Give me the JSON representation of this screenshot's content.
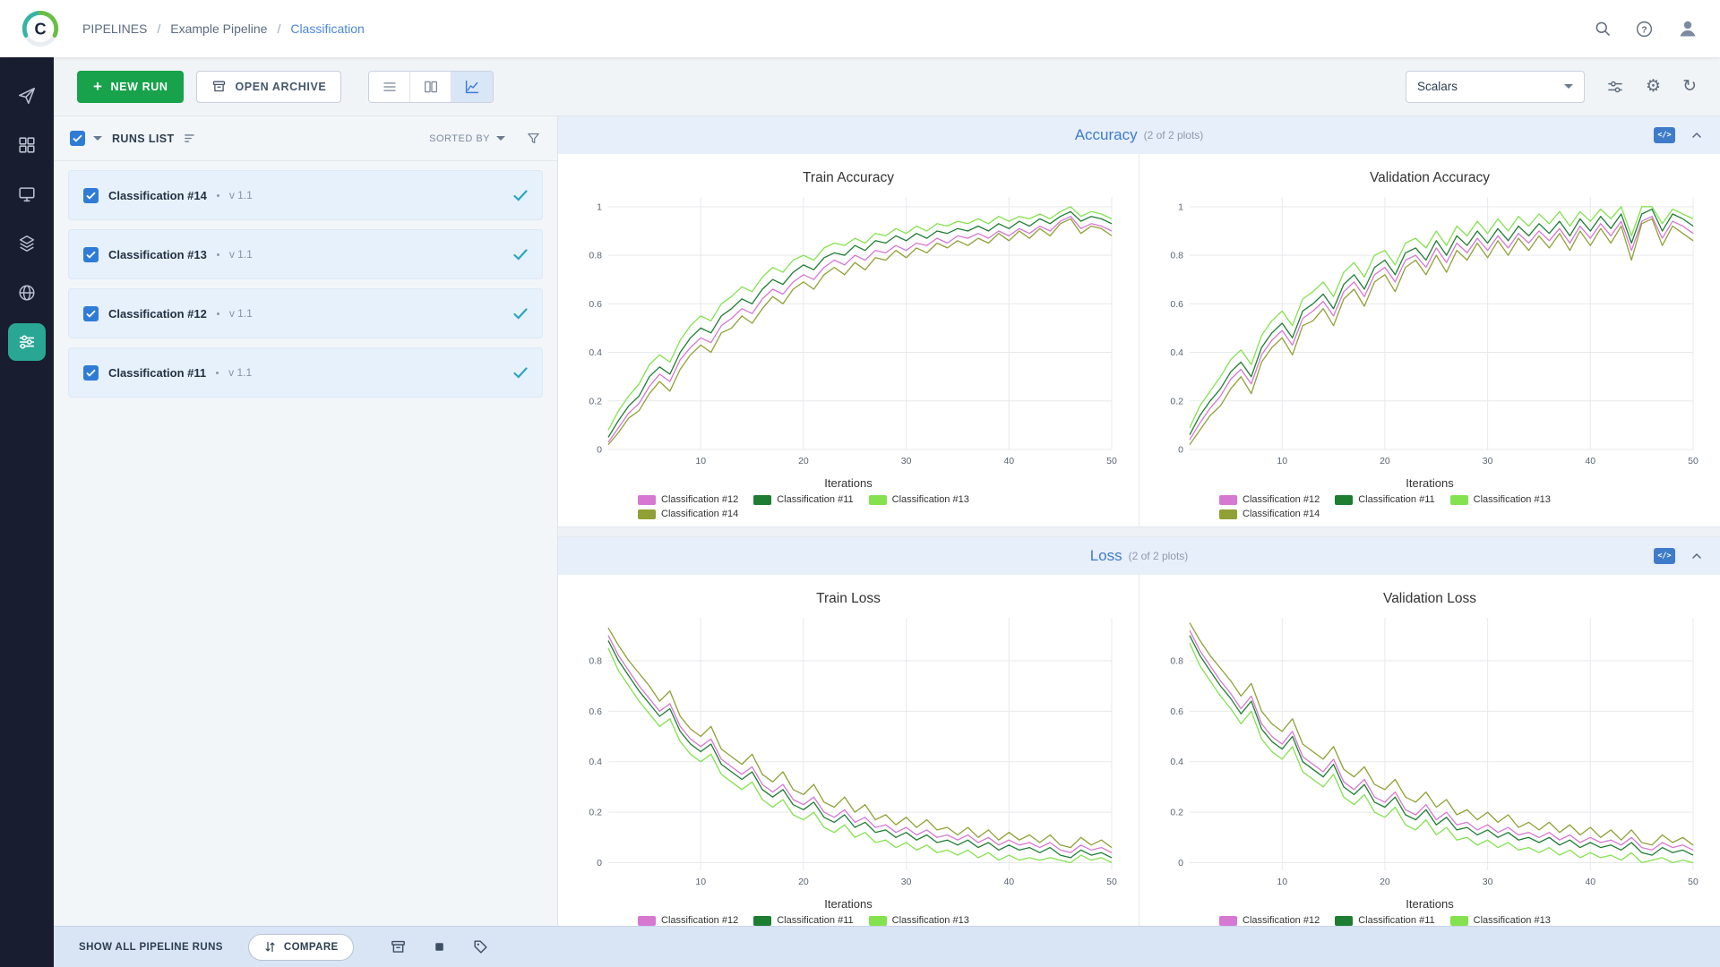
{
  "topbar": {
    "breadcrumb": [
      {
        "label": "PIPELINES"
      },
      {
        "label": "Example Pipeline"
      },
      {
        "label": "Classification"
      }
    ]
  },
  "rail": {
    "items": [
      {
        "name": "getting-started"
      },
      {
        "name": "projects"
      },
      {
        "name": "workers-queues"
      },
      {
        "name": "datasets"
      },
      {
        "name": "reports"
      },
      {
        "name": "pipelines",
        "active": true
      }
    ]
  },
  "toolbar": {
    "new_run_label": "NEW RUN",
    "open_archive_label": "OPEN ARCHIVE",
    "metric_view_label": "Scalars"
  },
  "runs_panel": {
    "title": "RUNS LIST",
    "sorted_by_label": "SORTED BY",
    "runs": [
      {
        "name": "Classification #14",
        "version": "v 1.1",
        "checked": true
      },
      {
        "name": "Classification #13",
        "version": "v 1.1",
        "checked": true
      },
      {
        "name": "Classification #12",
        "version": "v 1.1",
        "checked": true
      },
      {
        "name": "Classification #11",
        "version": "v 1.1",
        "checked": true
      }
    ]
  },
  "sections": [
    {
      "title": "Accuracy",
      "subtitle": "(2 of 2 plots)"
    },
    {
      "title": "Loss",
      "subtitle": "(2 of 2 plots)"
    }
  ],
  "bottombar": {
    "show_all_label": "SHOW ALL PIPELINE RUNS",
    "compare_label": "COMPARE"
  },
  "run_colors": {
    "Classification #12": "#d678d2",
    "Classification #11": "#1d7d31",
    "Classification #13": "#84e24e",
    "Classification #14": "#90a035"
  },
  "chart_data": [
    {
      "type": "line",
      "id": "train-accuracy",
      "title": "Train Accuracy",
      "xlabel": "Iterations",
      "xlim": [
        1,
        50
      ],
      "ylim": [
        0,
        1.04
      ],
      "xticks": [
        10,
        20,
        30,
        40,
        50
      ],
      "yticks": [
        0,
        0.2,
        0.4,
        0.6,
        0.8,
        1
      ],
      "series": [
        {
          "name": "Classification #12",
          "values": [
            0.03,
            0.09,
            0.15,
            0.19,
            0.26,
            0.31,
            0.28,
            0.37,
            0.42,
            0.46,
            0.44,
            0.51,
            0.54,
            0.58,
            0.56,
            0.62,
            0.66,
            0.64,
            0.69,
            0.72,
            0.7,
            0.75,
            0.78,
            0.76,
            0.8,
            0.78,
            0.82,
            0.81,
            0.84,
            0.82,
            0.85,
            0.84,
            0.87,
            0.85,
            0.88,
            0.87,
            0.89,
            0.87,
            0.9,
            0.88,
            0.91,
            0.89,
            0.92,
            0.9,
            0.94,
            0.96,
            0.91,
            0.93,
            0.92,
            0.9
          ]
        },
        {
          "name": "Classification #11",
          "values": [
            0.05,
            0.12,
            0.18,
            0.22,
            0.3,
            0.34,
            0.31,
            0.4,
            0.46,
            0.5,
            0.48,
            0.55,
            0.58,
            0.62,
            0.6,
            0.66,
            0.7,
            0.68,
            0.73,
            0.76,
            0.74,
            0.79,
            0.81,
            0.8,
            0.84,
            0.82,
            0.86,
            0.85,
            0.88,
            0.86,
            0.89,
            0.87,
            0.9,
            0.89,
            0.91,
            0.9,
            0.92,
            0.9,
            0.93,
            0.91,
            0.94,
            0.92,
            0.95,
            0.93,
            0.96,
            0.98,
            0.94,
            0.96,
            0.95,
            0.93
          ]
        },
        {
          "name": "Classification #13",
          "values": [
            0.08,
            0.16,
            0.22,
            0.27,
            0.35,
            0.39,
            0.36,
            0.45,
            0.51,
            0.55,
            0.53,
            0.6,
            0.63,
            0.67,
            0.65,
            0.71,
            0.75,
            0.73,
            0.78,
            0.8,
            0.78,
            0.83,
            0.85,
            0.84,
            0.87,
            0.85,
            0.89,
            0.88,
            0.91,
            0.89,
            0.92,
            0.9,
            0.93,
            0.92,
            0.94,
            0.93,
            0.95,
            0.93,
            0.96,
            0.94,
            0.96,
            0.95,
            0.97,
            0.95,
            0.98,
            1.0,
            0.96,
            0.98,
            0.97,
            0.95
          ]
        },
        {
          "name": "Classification #14",
          "values": [
            0.02,
            0.07,
            0.13,
            0.16,
            0.23,
            0.28,
            0.24,
            0.33,
            0.39,
            0.43,
            0.4,
            0.48,
            0.5,
            0.55,
            0.52,
            0.58,
            0.63,
            0.6,
            0.66,
            0.69,
            0.66,
            0.72,
            0.75,
            0.72,
            0.77,
            0.74,
            0.79,
            0.78,
            0.82,
            0.79,
            0.83,
            0.81,
            0.85,
            0.83,
            0.86,
            0.84,
            0.87,
            0.85,
            0.89,
            0.86,
            0.9,
            0.87,
            0.91,
            0.88,
            0.93,
            0.95,
            0.89,
            0.92,
            0.91,
            0.88
          ]
        }
      ]
    },
    {
      "type": "line",
      "id": "validation-accuracy",
      "title": "Validation Accuracy",
      "xlabel": "Iterations",
      "xlim": [
        1,
        50
      ],
      "ylim": [
        0,
        1.04
      ],
      "xticks": [
        10,
        20,
        30,
        40,
        50
      ],
      "yticks": [
        0,
        0.2,
        0.4,
        0.6,
        0.8,
        1
      ],
      "series": [
        {
          "name": "Classification #12",
          "values": [
            0.04,
            0.11,
            0.17,
            0.22,
            0.29,
            0.33,
            0.27,
            0.39,
            0.45,
            0.49,
            0.43,
            0.54,
            0.57,
            0.61,
            0.55,
            0.65,
            0.69,
            0.63,
            0.72,
            0.75,
            0.69,
            0.78,
            0.8,
            0.75,
            0.83,
            0.77,
            0.85,
            0.81,
            0.87,
            0.82,
            0.88,
            0.83,
            0.89,
            0.85,
            0.9,
            0.86,
            0.91,
            0.85,
            0.92,
            0.87,
            0.93,
            0.88,
            0.94,
            0.82,
            0.94,
            0.96,
            0.87,
            0.94,
            0.92,
            0.89
          ]
        },
        {
          "name": "Classification #11",
          "values": [
            0.06,
            0.14,
            0.2,
            0.25,
            0.32,
            0.36,
            0.3,
            0.42,
            0.48,
            0.52,
            0.46,
            0.57,
            0.6,
            0.64,
            0.58,
            0.68,
            0.72,
            0.66,
            0.75,
            0.78,
            0.72,
            0.81,
            0.83,
            0.78,
            0.86,
            0.8,
            0.88,
            0.84,
            0.9,
            0.85,
            0.91,
            0.86,
            0.92,
            0.88,
            0.93,
            0.89,
            0.94,
            0.88,
            0.95,
            0.9,
            0.96,
            0.91,
            0.97,
            0.85,
            0.97,
            0.99,
            0.9,
            0.97,
            0.95,
            0.92
          ]
        },
        {
          "name": "Classification #13",
          "values": [
            0.09,
            0.18,
            0.24,
            0.3,
            0.37,
            0.41,
            0.35,
            0.47,
            0.53,
            0.57,
            0.51,
            0.62,
            0.65,
            0.69,
            0.63,
            0.73,
            0.77,
            0.71,
            0.8,
            0.82,
            0.76,
            0.85,
            0.87,
            0.83,
            0.9,
            0.84,
            0.92,
            0.88,
            0.94,
            0.89,
            0.95,
            0.9,
            0.96,
            0.92,
            0.97,
            0.93,
            0.98,
            0.92,
            0.98,
            0.94,
            0.99,
            0.95,
            1.0,
            0.88,
            1.0,
            1.0,
            0.93,
            0.99,
            0.97,
            0.95
          ]
        },
        {
          "name": "Classification #14",
          "values": [
            0.02,
            0.08,
            0.14,
            0.18,
            0.25,
            0.3,
            0.23,
            0.36,
            0.42,
            0.46,
            0.39,
            0.51,
            0.53,
            0.58,
            0.51,
            0.62,
            0.66,
            0.59,
            0.69,
            0.72,
            0.65,
            0.75,
            0.78,
            0.72,
            0.8,
            0.73,
            0.82,
            0.78,
            0.85,
            0.79,
            0.86,
            0.8,
            0.87,
            0.82,
            0.88,
            0.83,
            0.89,
            0.82,
            0.9,
            0.84,
            0.91,
            0.85,
            0.92,
            0.78,
            0.93,
            0.95,
            0.84,
            0.92,
            0.89,
            0.86
          ]
        }
      ]
    },
    {
      "type": "line",
      "id": "train-loss",
      "title": "Train Loss",
      "xlabel": "Iterations",
      "xlim": [
        1,
        50
      ],
      "ylim": [
        -0.03,
        0.97
      ],
      "xticks": [
        10,
        20,
        30,
        40,
        50
      ],
      "yticks": [
        0,
        0.2,
        0.4,
        0.6,
        0.8
      ],
      "series": [
        {
          "name": "Classification #12",
          "values": [
            0.9,
            0.82,
            0.76,
            0.7,
            0.65,
            0.6,
            0.63,
            0.54,
            0.49,
            0.46,
            0.49,
            0.41,
            0.38,
            0.35,
            0.38,
            0.31,
            0.28,
            0.31,
            0.25,
            0.23,
            0.26,
            0.2,
            0.18,
            0.21,
            0.16,
            0.18,
            0.14,
            0.15,
            0.12,
            0.14,
            0.11,
            0.13,
            0.1,
            0.11,
            0.09,
            0.11,
            0.08,
            0.1,
            0.07,
            0.09,
            0.07,
            0.08,
            0.06,
            0.08,
            0.05,
            0.04,
            0.07,
            0.05,
            0.06,
            0.04
          ]
        },
        {
          "name": "Classification #11",
          "values": [
            0.88,
            0.8,
            0.74,
            0.68,
            0.63,
            0.58,
            0.61,
            0.52,
            0.47,
            0.44,
            0.47,
            0.39,
            0.36,
            0.33,
            0.36,
            0.29,
            0.26,
            0.29,
            0.23,
            0.21,
            0.24,
            0.18,
            0.16,
            0.19,
            0.14,
            0.16,
            0.12,
            0.13,
            0.1,
            0.12,
            0.09,
            0.11,
            0.08,
            0.09,
            0.07,
            0.09,
            0.06,
            0.08,
            0.05,
            0.07,
            0.05,
            0.06,
            0.04,
            0.06,
            0.03,
            0.02,
            0.05,
            0.03,
            0.04,
            0.02
          ]
        },
        {
          "name": "Classification #13",
          "values": [
            0.85,
            0.76,
            0.7,
            0.64,
            0.59,
            0.54,
            0.57,
            0.48,
            0.43,
            0.4,
            0.43,
            0.35,
            0.32,
            0.29,
            0.32,
            0.25,
            0.22,
            0.25,
            0.19,
            0.17,
            0.2,
            0.14,
            0.12,
            0.15,
            0.1,
            0.12,
            0.08,
            0.09,
            0.06,
            0.08,
            0.05,
            0.07,
            0.04,
            0.05,
            0.03,
            0.05,
            0.02,
            0.04,
            0.01,
            0.03,
            0.01,
            0.02,
            0.01,
            0.02,
            0.01,
            0.0,
            0.03,
            0.01,
            0.02,
            0.0
          ]
        },
        {
          "name": "Classification #14",
          "values": [
            0.93,
            0.86,
            0.8,
            0.75,
            0.7,
            0.64,
            0.68,
            0.58,
            0.53,
            0.5,
            0.54,
            0.45,
            0.42,
            0.39,
            0.43,
            0.35,
            0.32,
            0.36,
            0.29,
            0.27,
            0.31,
            0.24,
            0.22,
            0.26,
            0.2,
            0.23,
            0.17,
            0.19,
            0.15,
            0.18,
            0.14,
            0.17,
            0.13,
            0.14,
            0.11,
            0.14,
            0.1,
            0.13,
            0.09,
            0.12,
            0.09,
            0.11,
            0.08,
            0.11,
            0.07,
            0.06,
            0.1,
            0.07,
            0.09,
            0.06
          ]
        }
      ]
    },
    {
      "type": "line",
      "id": "validation-loss",
      "title": "Validation Loss",
      "xlabel": "Iterations",
      "xlim": [
        1,
        50
      ],
      "ylim": [
        -0.03,
        0.97
      ],
      "xticks": [
        10,
        20,
        30,
        40,
        50
      ],
      "yticks": [
        0,
        0.2,
        0.4,
        0.6,
        0.8
      ],
      "series": [
        {
          "name": "Classification #12",
          "values": [
            0.92,
            0.84,
            0.78,
            0.72,
            0.67,
            0.61,
            0.66,
            0.55,
            0.5,
            0.47,
            0.52,
            0.42,
            0.39,
            0.36,
            0.41,
            0.32,
            0.29,
            0.33,
            0.26,
            0.24,
            0.28,
            0.21,
            0.19,
            0.23,
            0.17,
            0.2,
            0.15,
            0.16,
            0.13,
            0.15,
            0.12,
            0.14,
            0.11,
            0.12,
            0.1,
            0.12,
            0.09,
            0.11,
            0.08,
            0.1,
            0.08,
            0.09,
            0.07,
            0.1,
            0.06,
            0.05,
            0.08,
            0.06,
            0.07,
            0.05
          ]
        },
        {
          "name": "Classification #11",
          "values": [
            0.9,
            0.82,
            0.76,
            0.7,
            0.65,
            0.59,
            0.64,
            0.53,
            0.48,
            0.45,
            0.5,
            0.4,
            0.37,
            0.34,
            0.39,
            0.3,
            0.27,
            0.31,
            0.24,
            0.22,
            0.26,
            0.19,
            0.17,
            0.21,
            0.15,
            0.18,
            0.13,
            0.14,
            0.11,
            0.13,
            0.1,
            0.12,
            0.09,
            0.1,
            0.08,
            0.1,
            0.07,
            0.09,
            0.06,
            0.08,
            0.06,
            0.07,
            0.05,
            0.08,
            0.04,
            0.03,
            0.06,
            0.04,
            0.05,
            0.03
          ]
        },
        {
          "name": "Classification #13",
          "values": [
            0.87,
            0.78,
            0.72,
            0.66,
            0.61,
            0.55,
            0.6,
            0.49,
            0.44,
            0.41,
            0.46,
            0.36,
            0.33,
            0.3,
            0.35,
            0.26,
            0.23,
            0.27,
            0.2,
            0.18,
            0.22,
            0.15,
            0.13,
            0.17,
            0.11,
            0.14,
            0.09,
            0.1,
            0.07,
            0.09,
            0.06,
            0.08,
            0.05,
            0.06,
            0.04,
            0.06,
            0.03,
            0.05,
            0.02,
            0.04,
            0.02,
            0.03,
            0.01,
            0.04,
            0.0,
            0.01,
            0.02,
            0.0,
            0.01,
            0.0
          ]
        },
        {
          "name": "Classification #14",
          "values": [
            0.95,
            0.88,
            0.82,
            0.77,
            0.72,
            0.66,
            0.71,
            0.6,
            0.55,
            0.52,
            0.57,
            0.47,
            0.44,
            0.41,
            0.46,
            0.37,
            0.34,
            0.38,
            0.31,
            0.29,
            0.33,
            0.26,
            0.24,
            0.28,
            0.22,
            0.25,
            0.19,
            0.21,
            0.17,
            0.2,
            0.16,
            0.19,
            0.14,
            0.16,
            0.13,
            0.16,
            0.12,
            0.15,
            0.11,
            0.14,
            0.1,
            0.13,
            0.09,
            0.13,
            0.08,
            0.07,
            0.11,
            0.08,
            0.1,
            0.07
          ]
        }
      ]
    }
  ]
}
